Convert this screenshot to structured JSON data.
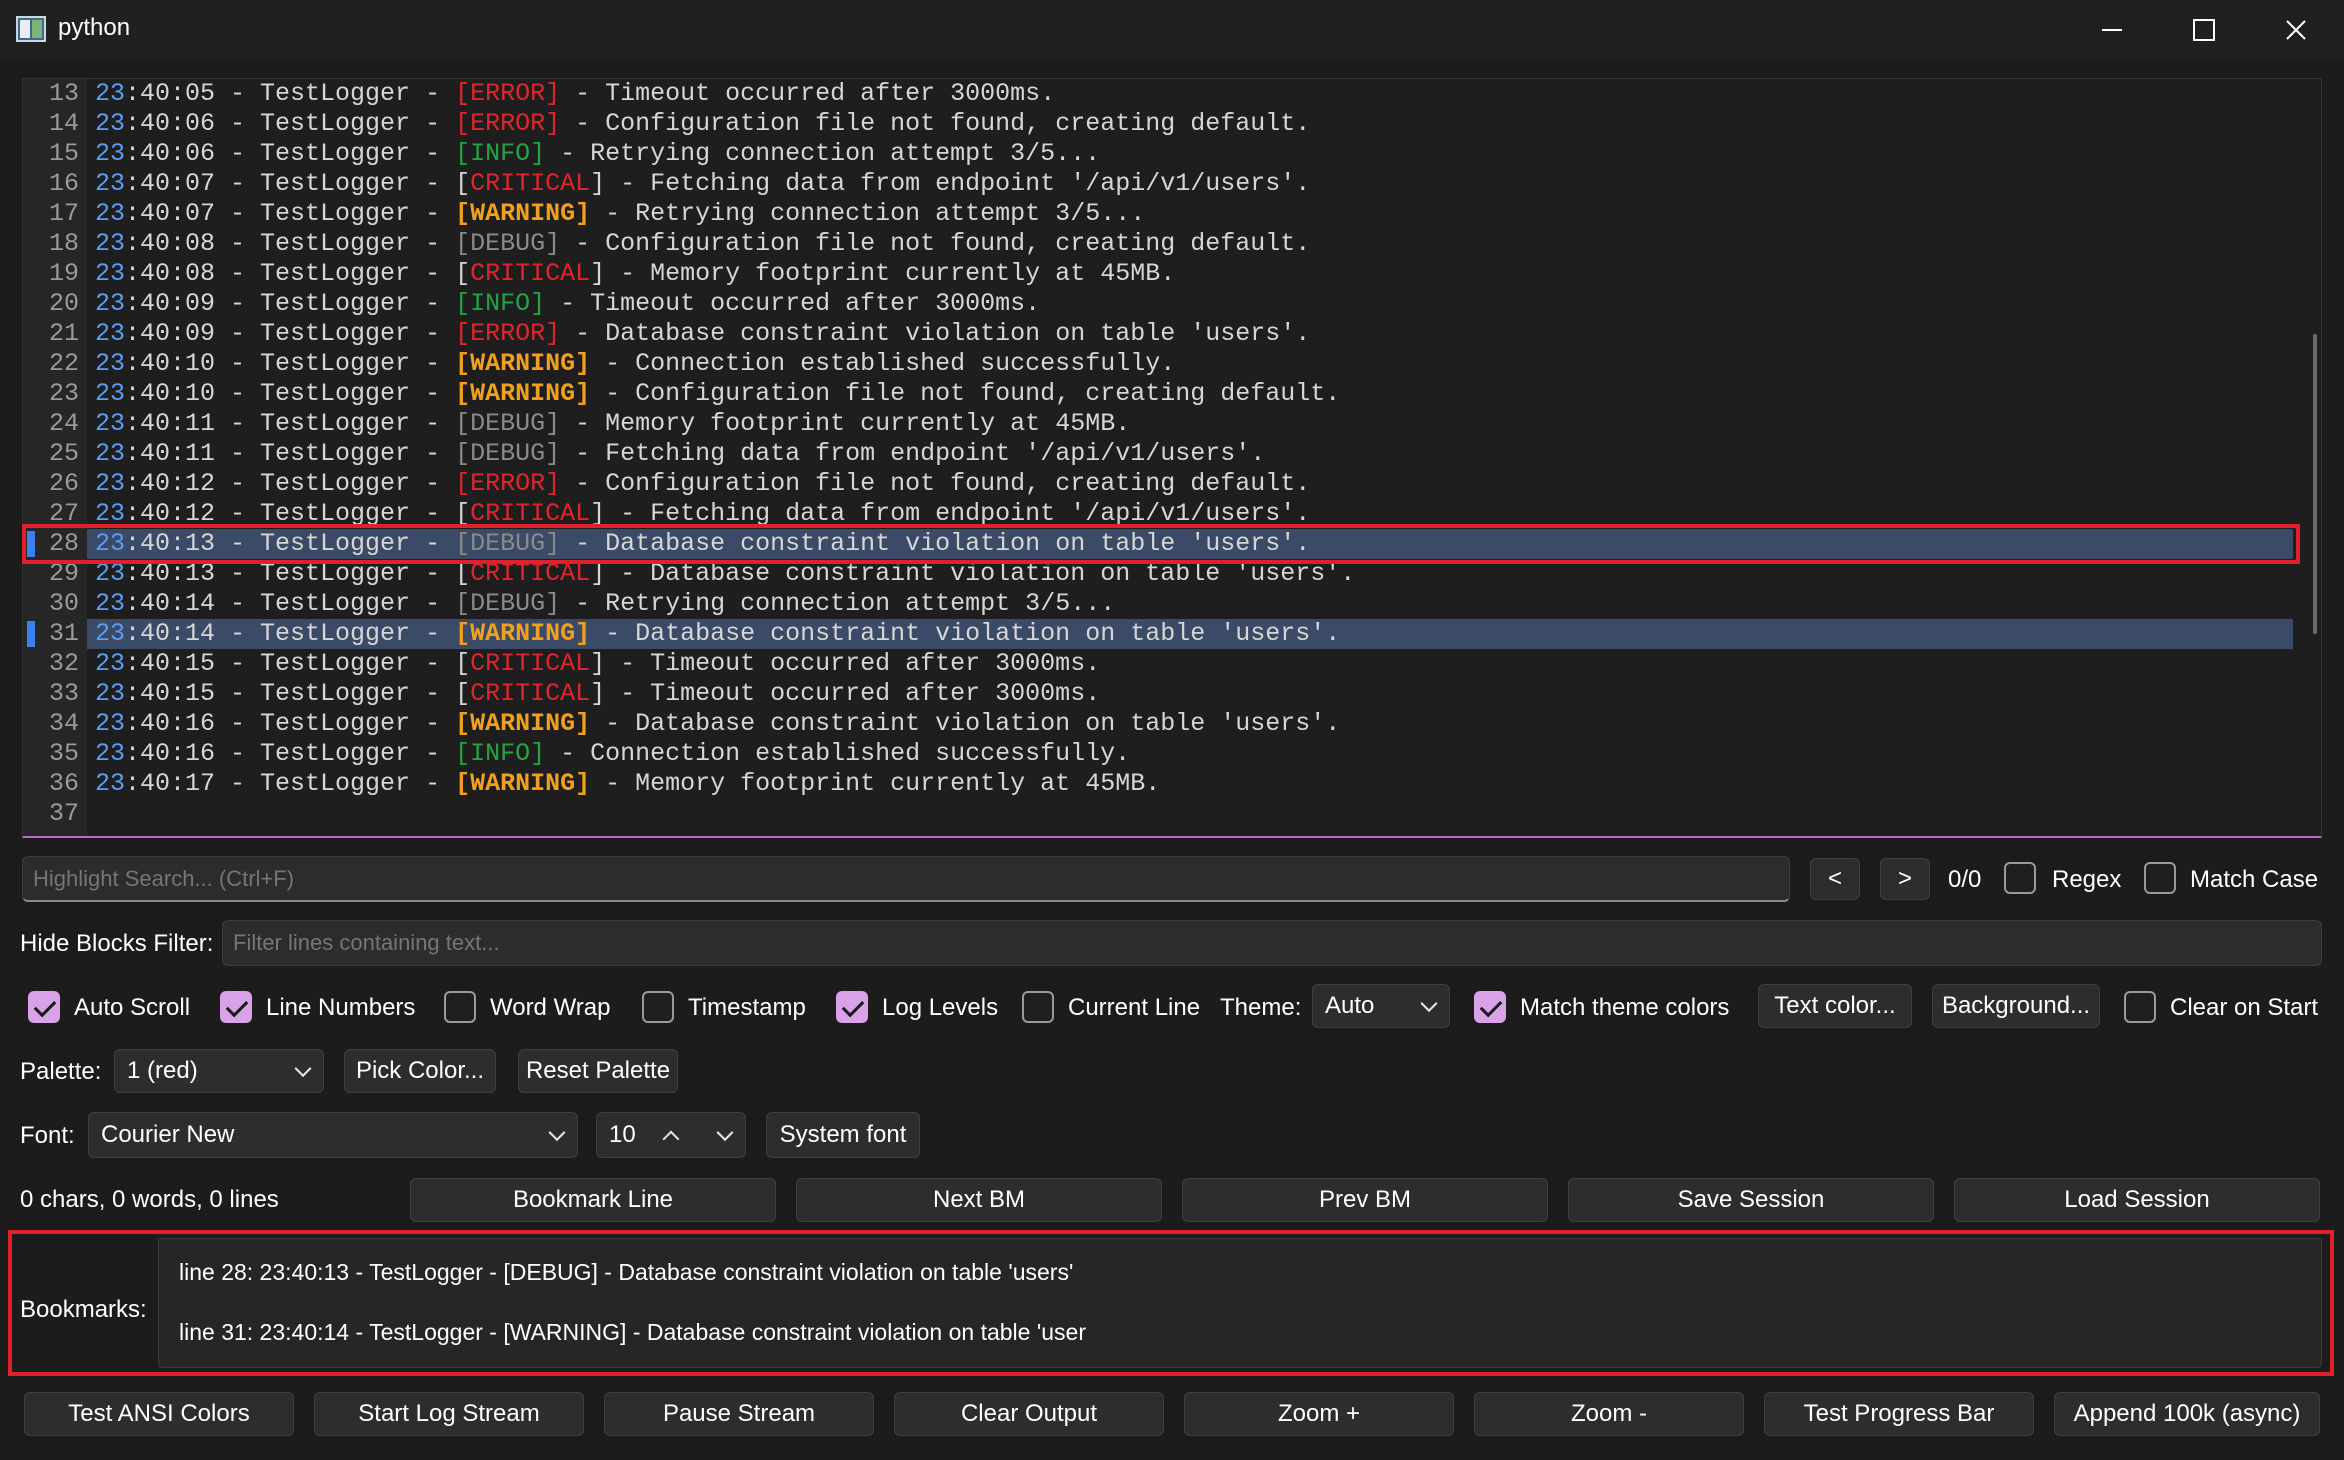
{
  "window": {
    "title": "python"
  },
  "log": {
    "lines": [
      {
        "n": "13",
        "hour": "23",
        "rest": ":40:05 - TestLogger - ",
        "level": "[ERROR]",
        "level_class": "lv-error",
        "msg": " - Timeout occurred after 3000ms.",
        "bookmarked": false
      },
      {
        "n": "14",
        "hour": "23",
        "rest": ":40:06 - TestLogger - ",
        "level": "[ERROR]",
        "level_class": "lv-error",
        "msg": " - Configuration file not found, creating default.",
        "bookmarked": false
      },
      {
        "n": "15",
        "hour": "23",
        "rest": ":40:06 - TestLogger - ",
        "level": "[INFO]",
        "level_class": "lv-info",
        "msg": " - Retrying connection attempt 3/5...",
        "bookmarked": false
      },
      {
        "n": "16",
        "hour": "23",
        "rest": ":40:07 - TestLogger - [",
        "level": "CRITICAL",
        "level_class": "lv-critical",
        "msg": "] - Fetching data from endpoint '/api/v1/users'.",
        "bookmarked": false
      },
      {
        "n": "17",
        "hour": "23",
        "rest": ":40:07 - TestLogger - ",
        "level": "[WARNING]",
        "level_class": "lv-warning",
        "msg": " - Retrying connection attempt 3/5...",
        "bookmarked": false
      },
      {
        "n": "18",
        "hour": "23",
        "rest": ":40:08 - TestLogger - ",
        "level": "[DEBUG]",
        "level_class": "lv-debug",
        "msg": " - Configuration file not found, creating default.",
        "bookmarked": false
      },
      {
        "n": "19",
        "hour": "23",
        "rest": ":40:08 - TestLogger - [",
        "level": "CRITICAL",
        "level_class": "lv-critical",
        "msg": "] - Memory footprint currently at 45MB.",
        "bookmarked": false
      },
      {
        "n": "20",
        "hour": "23",
        "rest": ":40:09 - TestLogger - ",
        "level": "[INFO]",
        "level_class": "lv-info",
        "msg": " - Timeout occurred after 3000ms.",
        "bookmarked": false
      },
      {
        "n": "21",
        "hour": "23",
        "rest": ":40:09 - TestLogger - ",
        "level": "[ERROR]",
        "level_class": "lv-error",
        "msg": " - Database constraint violation on table 'users'.",
        "bookmarked": false
      },
      {
        "n": "22",
        "hour": "23",
        "rest": ":40:10 - TestLogger - ",
        "level": "[WARNING]",
        "level_class": "lv-warning",
        "msg": " - Connection established successfully.",
        "bookmarked": false
      },
      {
        "n": "23",
        "hour": "23",
        "rest": ":40:10 - TestLogger - ",
        "level": "[WARNING]",
        "level_class": "lv-warning",
        "msg": " - Configuration file not found, creating default.",
        "bookmarked": false
      },
      {
        "n": "24",
        "hour": "23",
        "rest": ":40:11 - TestLogger - ",
        "level": "[DEBUG]",
        "level_class": "lv-debug",
        "msg": " - Memory footprint currently at 45MB.",
        "bookmarked": false
      },
      {
        "n": "25",
        "hour": "23",
        "rest": ":40:11 - TestLogger - ",
        "level": "[DEBUG]",
        "level_class": "lv-debug",
        "msg": " - Fetching data from endpoint '/api/v1/users'.",
        "bookmarked": false
      },
      {
        "n": "26",
        "hour": "23",
        "rest": ":40:12 - TestLogger - ",
        "level": "[ERROR]",
        "level_class": "lv-error",
        "msg": " - Configuration file not found, creating default.",
        "bookmarked": false
      },
      {
        "n": "27",
        "hour": "23",
        "rest": ":40:12 - TestLogger - [",
        "level": "CRITICAL",
        "level_class": "lv-critical",
        "msg": "] - Fetching data from endpoint '/api/v1/users'.",
        "bookmarked": false
      },
      {
        "n": "28",
        "hour": "23",
        "rest": ":40:13 - TestLogger - ",
        "level": "[DEBUG]",
        "level_class": "lv-debug",
        "msg": " - Database constraint violation on table 'users'.",
        "bookmarked": true
      },
      {
        "n": "29",
        "hour": "23",
        "rest": ":40:13 - TestLogger - [",
        "level": "CRITICAL",
        "level_class": "lv-critical",
        "msg": "] - Database constraint violation on table 'users'.",
        "bookmarked": false
      },
      {
        "n": "30",
        "hour": "23",
        "rest": ":40:14 - TestLogger - ",
        "level": "[DEBUG]",
        "level_class": "lv-debug",
        "msg": " - Retrying connection attempt 3/5...",
        "bookmarked": false
      },
      {
        "n": "31",
        "hour": "23",
        "rest": ":40:14 - TestLogger - ",
        "level": "[WARNING]",
        "level_class": "lv-warning",
        "msg": " - Database constraint violation on table 'users'.",
        "bookmarked": true
      },
      {
        "n": "32",
        "hour": "23",
        "rest": ":40:15 - TestLogger - [",
        "level": "CRITICAL",
        "level_class": "lv-critical",
        "msg": "] - Timeout occurred after 3000ms.",
        "bookmarked": false
      },
      {
        "n": "33",
        "hour": "23",
        "rest": ":40:15 - TestLogger - [",
        "level": "CRITICAL",
        "level_class": "lv-critical",
        "msg": "] - Timeout occurred after 3000ms.",
        "bookmarked": false
      },
      {
        "n": "34",
        "hour": "23",
        "rest": ":40:16 - TestLogger - ",
        "level": "[WARNING]",
        "level_class": "lv-warning",
        "msg": " - Database constraint violation on table 'users'.",
        "bookmarked": false
      },
      {
        "n": "35",
        "hour": "23",
        "rest": ":40:16 - TestLogger - ",
        "level": "[INFO]",
        "level_class": "lv-info",
        "msg": " - Connection established successfully.",
        "bookmarked": false
      },
      {
        "n": "36",
        "hour": "23",
        "rest": ":40:17 - TestLogger - ",
        "level": "[WARNING]",
        "level_class": "lv-warning",
        "msg": " - Memory footprint currently at 45MB.",
        "bookmarked": false
      },
      {
        "n": "37",
        "hour": "",
        "rest": "",
        "level": "",
        "level_class": "",
        "msg": "",
        "bookmarked": false
      }
    ]
  },
  "search": {
    "placeholder": "Highlight Search... (Ctrl+F)",
    "prev_label": "<",
    "next_label": ">",
    "count": "0/0",
    "regex_label": "Regex",
    "match_case_label": "Match Case"
  },
  "filter": {
    "label": "Hide Blocks Filter:",
    "placeholder": "Filter lines containing text..."
  },
  "options": {
    "auto_scroll": "Auto Scroll",
    "line_numbers": "Line Numbers",
    "word_wrap": "Word Wrap",
    "timestamp": "Timestamp",
    "log_levels": "Log Levels",
    "current_line": "Current Line",
    "theme_label": "Theme:",
    "theme_value": "Auto",
    "match_theme_colors": "Match theme colors",
    "text_color_button": "Text color...",
    "background_button": "Background...",
    "clear_on_start": "Clear on Start"
  },
  "palette": {
    "label": "Palette:",
    "value": "1 (red)",
    "pick_color": "Pick Color...",
    "reset_palette": "Reset Palette"
  },
  "font": {
    "label": "Font:",
    "family": "Courier New",
    "size": "10",
    "system_font": "System font"
  },
  "stats": {
    "text": "0 chars, 0 words, 0 lines"
  },
  "bookmark_actions": {
    "bookmark_line": "Bookmark Line",
    "next_bm": "Next BM",
    "prev_bm": "Prev BM",
    "save_session": "Save Session",
    "load_session": "Load Session"
  },
  "bookmarks": {
    "label": "Bookmarks:",
    "items": [
      "line 28: 23:40:13 - TestLogger - [DEBUG] - Database constraint violation on table 'users'",
      "line 31: 23:40:14 - TestLogger - [WARNING] - Database constraint violation on table 'user"
    ]
  },
  "bottom_bar": {
    "test_ansi": "Test ANSI Colors",
    "start_stream": "Start Log Stream",
    "pause_stream": "Pause Stream",
    "clear_output": "Clear Output",
    "zoom_in": "Zoom +",
    "zoom_out": "Zoom -",
    "test_progress": "Test Progress Bar",
    "append_100k": "Append 100k (async)"
  },
  "colors": {
    "accent": "#d9a2e6",
    "bookmark_highlight": "#3b4a66",
    "annotation_box": "#e0202a",
    "error": "#e0252c",
    "info": "#25a244",
    "warning": "#f0a01e",
    "debug": "#8a8a8a",
    "timestamp_hour": "#5b9cf2"
  }
}
